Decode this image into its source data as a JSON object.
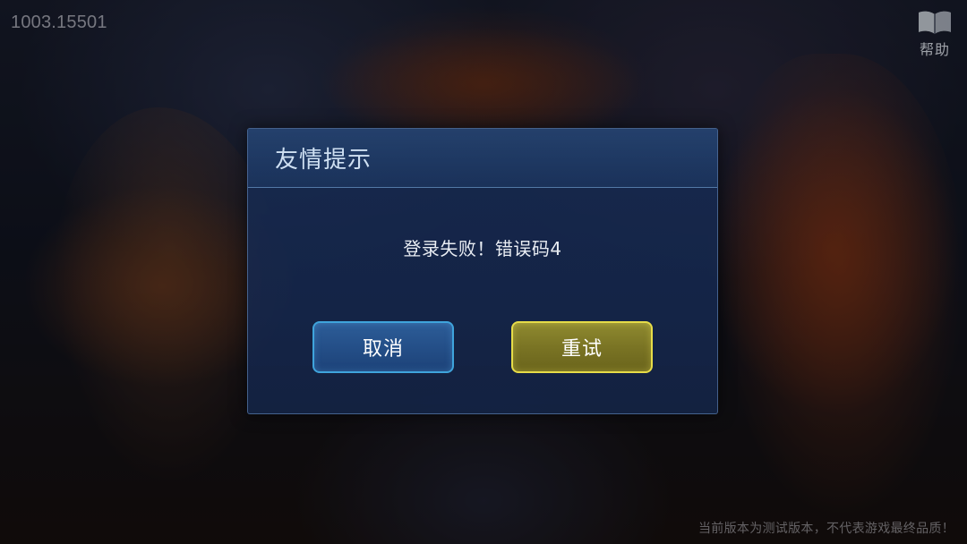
{
  "hud": {
    "version": "1003.15501",
    "help_label": "帮助",
    "help_icon": "book-icon",
    "disclaimer": "当前版本为测试版本，不代表游戏最终品质！"
  },
  "dialog": {
    "title": "友情提示",
    "message": "登录失败！错误码4",
    "cancel_label": "取消",
    "retry_label": "重试"
  },
  "colors": {
    "dialog_bg": "#1c3462",
    "cancel_border": "#3fa4dc",
    "retry_border": "#e6dc48"
  }
}
